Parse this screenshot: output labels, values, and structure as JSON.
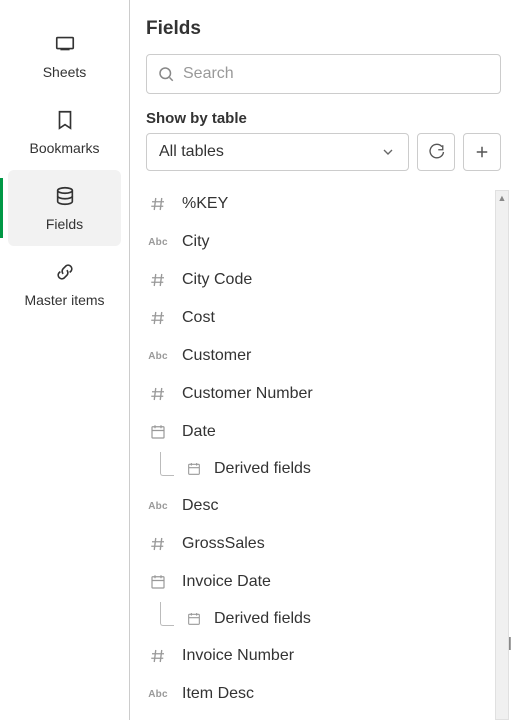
{
  "sidebar": {
    "items": [
      {
        "label": "Sheets"
      },
      {
        "label": "Bookmarks"
      },
      {
        "label": "Fields"
      },
      {
        "label": "Master items"
      }
    ]
  },
  "panel": {
    "title": "Fields",
    "search_placeholder": "Search",
    "showby_label": "Show by table",
    "table_select": "All tables",
    "derived_label": "Derived fields"
  },
  "fields": [
    {
      "type": "num",
      "name": "%KEY"
    },
    {
      "type": "abc",
      "name": "City"
    },
    {
      "type": "num",
      "name": "City Code"
    },
    {
      "type": "num",
      "name": "Cost"
    },
    {
      "type": "abc",
      "name": "Customer"
    },
    {
      "type": "num",
      "name": "Customer Number"
    },
    {
      "type": "date",
      "name": "Date",
      "derived": true
    },
    {
      "type": "abc",
      "name": "Desc"
    },
    {
      "type": "num",
      "name": "GrossSales"
    },
    {
      "type": "date",
      "name": "Invoice Date",
      "derived": true
    },
    {
      "type": "num",
      "name": "Invoice Number"
    },
    {
      "type": "abc",
      "name": "Item Desc"
    }
  ]
}
